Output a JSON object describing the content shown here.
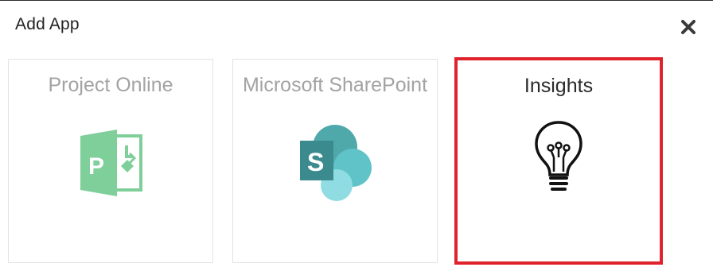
{
  "dialog": {
    "title": "Add App",
    "close_icon": "close-icon"
  },
  "apps": [
    {
      "label": "Project Online",
      "icon": "project-online-logo-icon",
      "state": "disabled"
    },
    {
      "label": "Microsoft SharePoint",
      "icon": "sharepoint-logo-icon",
      "state": "disabled"
    },
    {
      "label": "Insights",
      "icon": "lightbulb-icon",
      "state": "enabled",
      "highlighted": true
    }
  ],
  "colors": {
    "highlight_border": "#e0222c",
    "project_green": "#7fcf9a",
    "sharepoint_teal": "#5fb7bd",
    "disabled_text": "#a3a3a3",
    "enabled_text": "#2a2a2a"
  }
}
